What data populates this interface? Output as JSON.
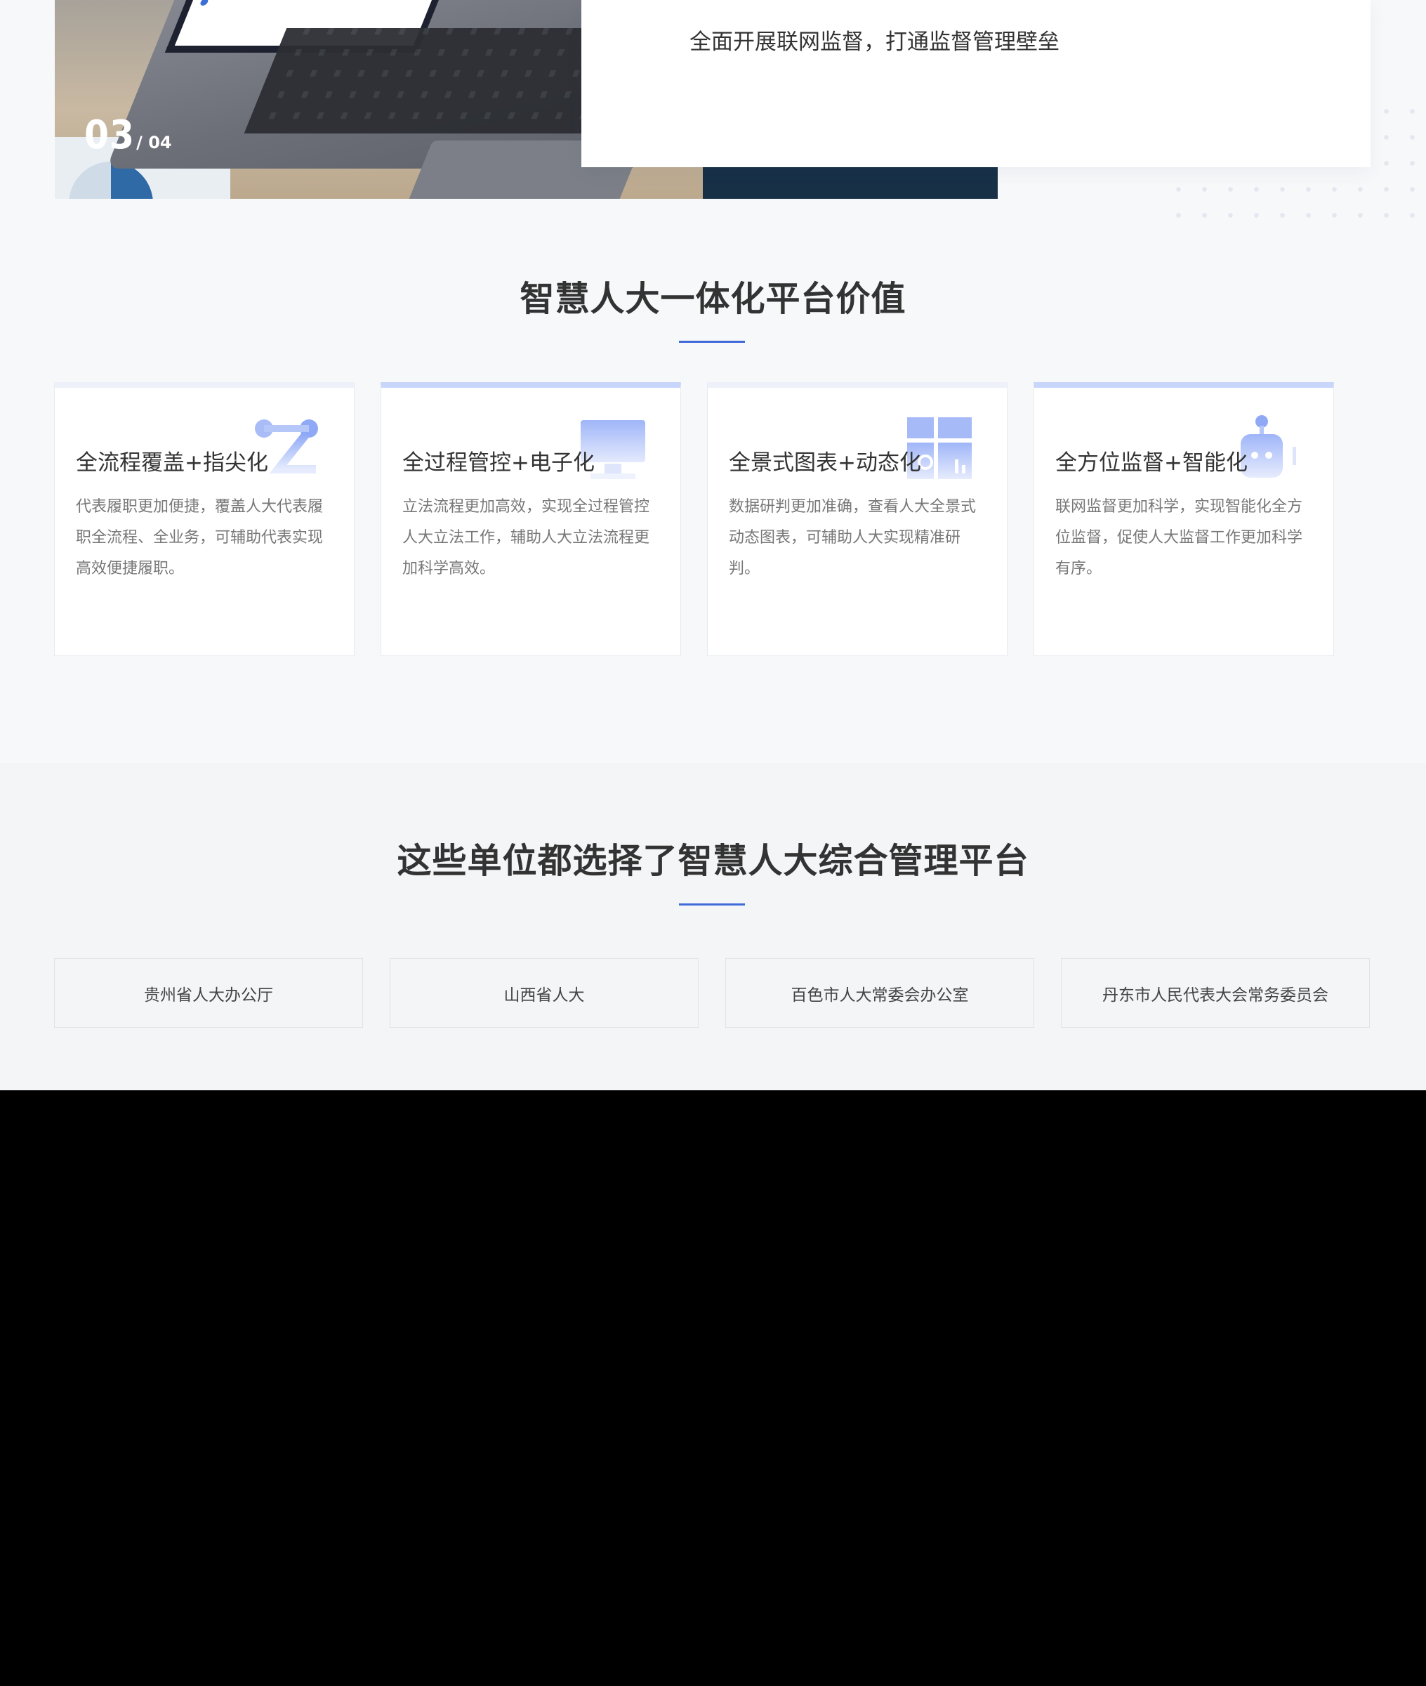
{
  "hero": {
    "slide_current": "03",
    "slide_total": "/ 04",
    "card_text": "全面开展联网监督，打通监督管理壁垒"
  },
  "values": {
    "title": "智慧人大一体化平台价值",
    "cards": [
      {
        "title": "全流程覆盖+指尖化",
        "desc": "代表履职更加便捷，覆盖人大代表履职全流程、全业务，可辅助代表实现高效便捷履职。",
        "icon": "flow-nodes-icon"
      },
      {
        "title": "全过程管控+电子化",
        "desc": "立法流程更加高效，实现全过程管控人大立法工作，辅助人大立法流程更加科学高效。",
        "icon": "monitor-icon"
      },
      {
        "title": "全景式图表+动态化",
        "desc": "数据研判更加准确，查看人大全景式动态图表，可辅助人大实现精准研判。",
        "icon": "dashboard-chart-icon"
      },
      {
        "title": "全方位监督+智能化",
        "desc": "联网监督更加科学，实现智能化全方位监督，促使人大监督工作更加科学有序。",
        "icon": "robot-icon"
      }
    ]
  },
  "clients": {
    "title": "这些单位都选择了智慧人大综合管理平台",
    "items": [
      "贵州省人大办公厅",
      "山西省人大",
      "百色市人大常委会办公室",
      "丹东市人民代表大会常务委员会"
    ]
  },
  "colors": {
    "accent": "#3f6ad8",
    "icon_light": "#c3d0fb",
    "icon_mid": "#8fa9f6"
  }
}
